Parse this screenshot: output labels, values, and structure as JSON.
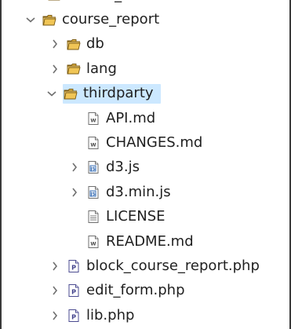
{
  "tree": {
    "items": [
      {
        "label": "course_overview",
        "expanded": false,
        "type": "folder"
      },
      {
        "label": "course_report",
        "expanded": true,
        "type": "folder"
      },
      {
        "label": "db",
        "expanded": false,
        "type": "folder"
      },
      {
        "label": "lang",
        "expanded": false,
        "type": "folder"
      },
      {
        "label": "thirdparty",
        "expanded": true,
        "type": "folder",
        "selected": true
      },
      {
        "label": "API.md",
        "type": "md-file"
      },
      {
        "label": "CHANGES.md",
        "type": "md-file"
      },
      {
        "label": "d3.js",
        "expanded": false,
        "type": "js-file"
      },
      {
        "label": "d3.min.js",
        "expanded": false,
        "type": "js-file"
      },
      {
        "label": "LICENSE",
        "type": "text-file"
      },
      {
        "label": "README.md",
        "type": "md-file"
      },
      {
        "label": "block_course_report.php",
        "expanded": false,
        "type": "php-file"
      },
      {
        "label": "edit_form.php",
        "expanded": false,
        "type": "php-file"
      },
      {
        "label": "lib.php",
        "expanded": false,
        "type": "php-file"
      }
    ]
  },
  "colors": {
    "selection": "#cce8ff",
    "folder": "#e7b84a",
    "folder_outline": "#7a5a12",
    "twisty": "#6f6f6f",
    "text": "#1f1f1f"
  }
}
